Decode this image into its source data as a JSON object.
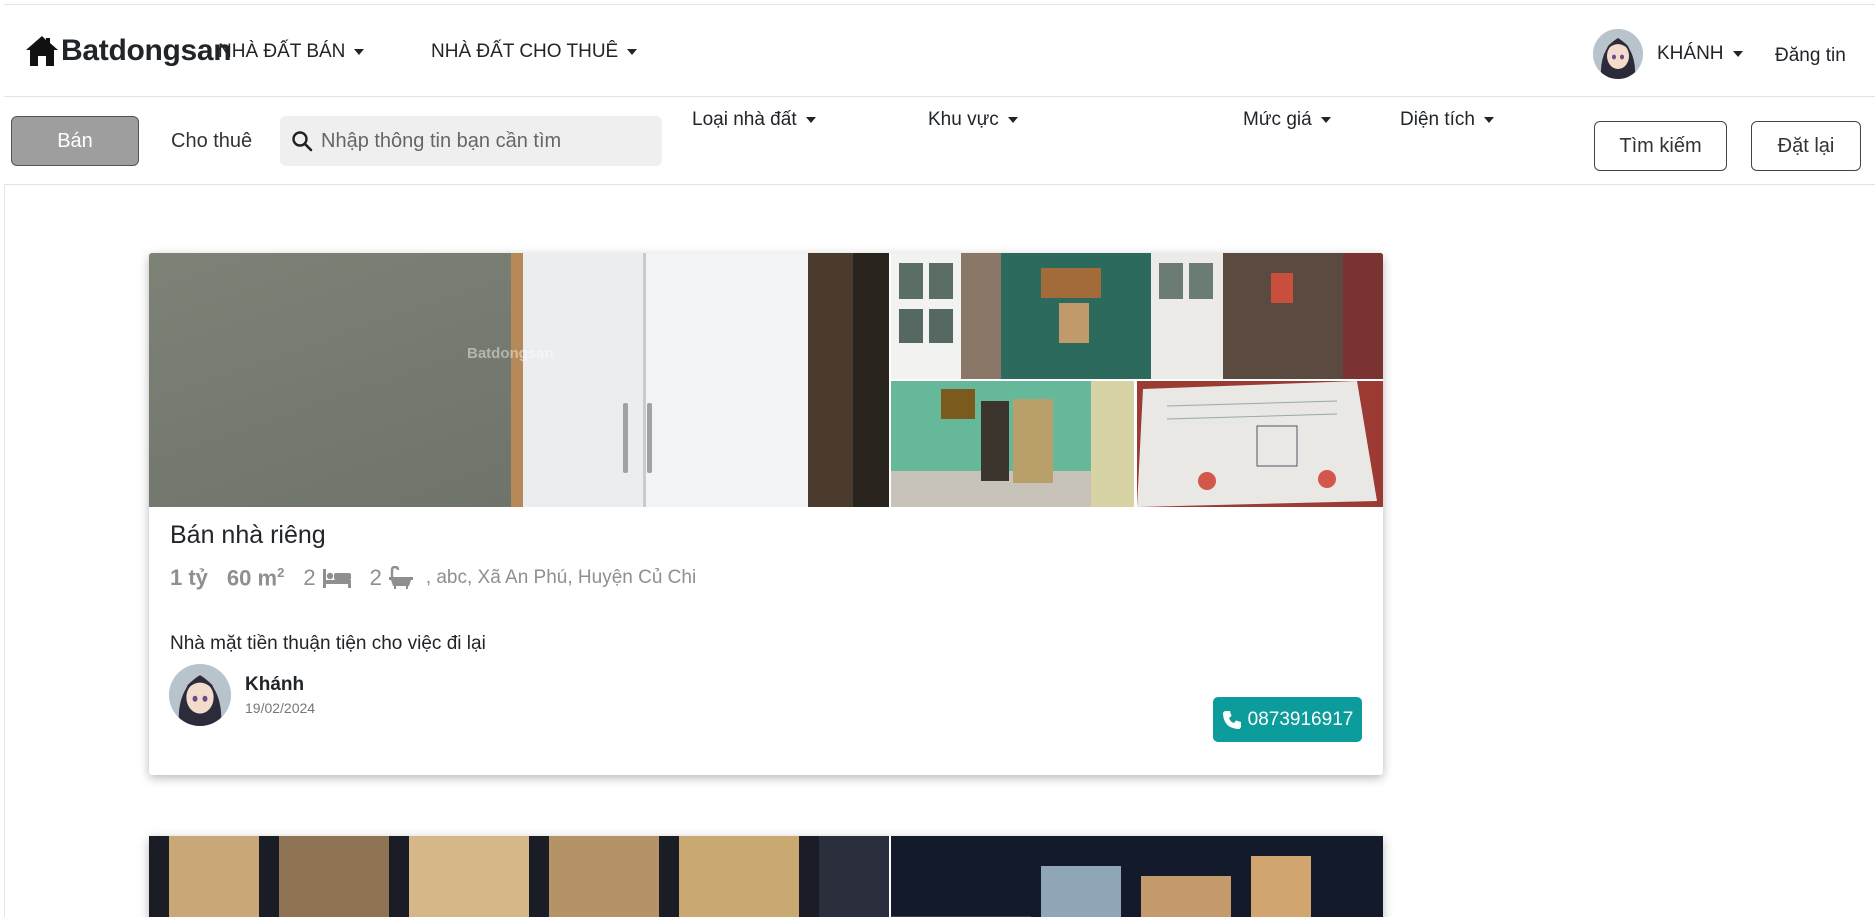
{
  "navbar": {
    "brand": "Batdongsan",
    "menu_sale": "NHÀ ĐẤT BÁN",
    "menu_rent": "NHÀ ĐẤT CHO THUÊ",
    "user_name": "KHÁNH",
    "post_label": "Đăng tin"
  },
  "search": {
    "tab_sale": "Bán",
    "tab_rent": "Cho thuê",
    "placeholder": "Nhập thông tin bạn cần tìm",
    "filters": {
      "type": "Loại nhà đất",
      "area": "Khu vực",
      "price": "Mức giá",
      "size": "Diện tích"
    },
    "search_button": "Tìm kiếm",
    "reset_button": "Đặt lại"
  },
  "listings": [
    {
      "title": "Bán nhà riêng",
      "price": "1 tỷ",
      "area_value": "60 m",
      "area_sup": "2",
      "bedrooms": "2",
      "bathrooms": "2",
      "address": ", abc, Xã An Phú, Huyện Củ Chi",
      "description": "Nhà mặt tiền thuận tiện cho việc đi lại",
      "author": "Khánh",
      "date": "19/02/2024",
      "phone": "0873916917",
      "watermark": "Batdongsan"
    }
  ],
  "colors": {
    "phone_button": "#0d9c9c",
    "active_tab": "#9e9e9e"
  },
  "icons": [
    "home-icon",
    "search-icon",
    "bed-icon",
    "bath-icon",
    "phone-icon",
    "caret-down-icon"
  ]
}
